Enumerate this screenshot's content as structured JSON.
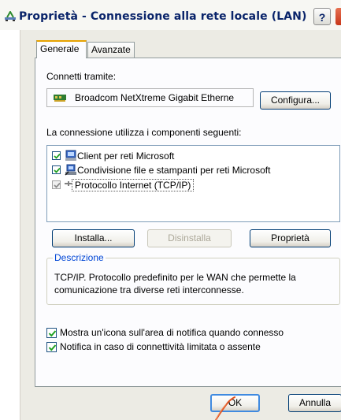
{
  "window": {
    "title": "Proprietà - Connessione alla rete locale (LAN)",
    "help_label": "?"
  },
  "tabs": [
    {
      "label": "Generale",
      "active": true
    },
    {
      "label": "Avanzate",
      "active": false
    }
  ],
  "connect_via": {
    "label": "Connetti tramite:",
    "adapter": "Broadcom NetXtreme Gigabit Etherne",
    "configure_button": "Configura..."
  },
  "components": {
    "label": "La connessione utilizza i componenti seguenti:",
    "items": [
      {
        "label": "Client per reti Microsoft",
        "checked": true,
        "icon": "network-client-icon"
      },
      {
        "label": "Condivisione file e stampanti per reti Microsoft",
        "checked": true,
        "icon": "file-printer-sharing-icon"
      },
      {
        "label": "Protocollo Internet (TCP/IP)",
        "checked": true,
        "icon": "protocol-icon",
        "selected": true
      }
    ]
  },
  "buttons": {
    "install": "Installa...",
    "uninstall": "Disinstalla",
    "properties": "Proprietà",
    "ok": "OK",
    "cancel": "Annulla"
  },
  "description": {
    "legend": "Descrizione",
    "text": "TCP/IP. Protocollo predefinito per le WAN che permette la comunicazione tra diverse reti interconnesse."
  },
  "options": [
    {
      "label": "Mostra un'icona sull'area di notifica quando connesso",
      "checked": true
    },
    {
      "label": "Notifica in caso di connettività limitata o assente",
      "checked": true
    }
  ],
  "colors": {
    "title_text": "#0a246a",
    "legend_text": "#0046d5",
    "annotation_stroke": "#e0501e"
  }
}
